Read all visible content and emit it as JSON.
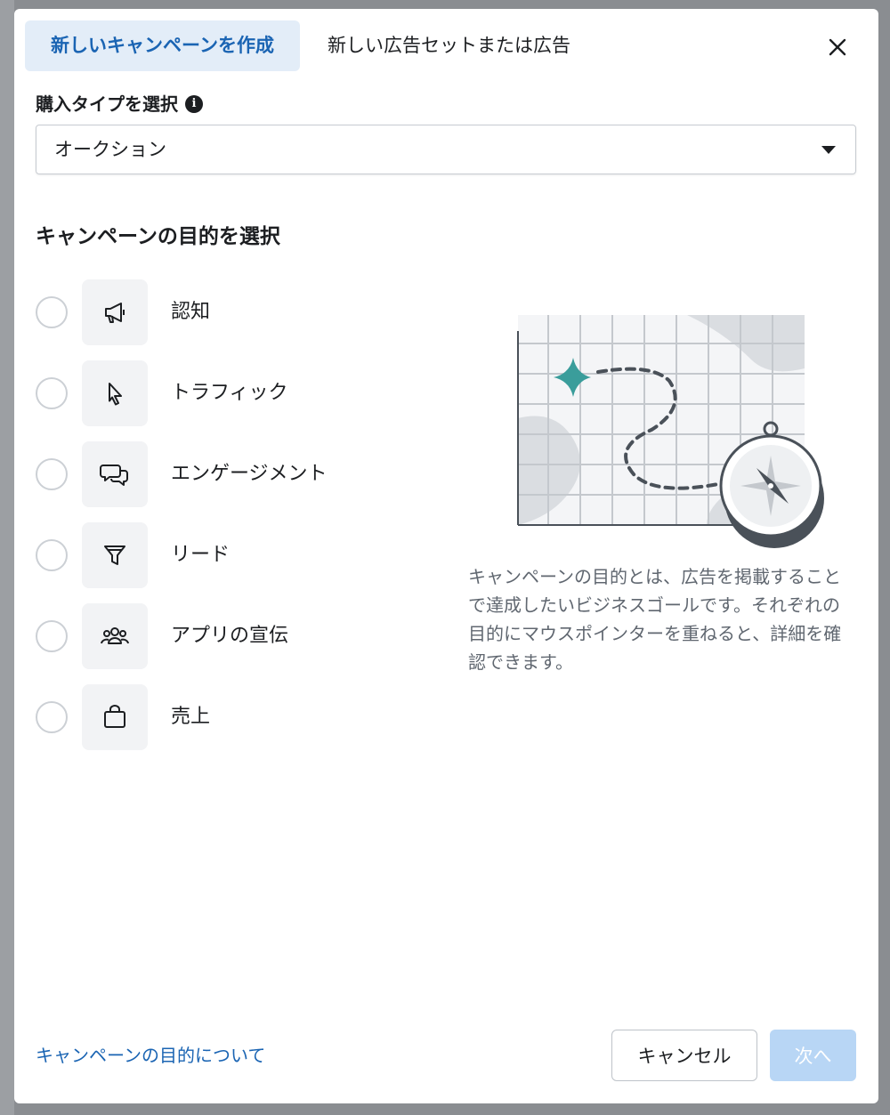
{
  "tabs": [
    {
      "label": "新しいキャンペーンを作成",
      "active": true
    },
    {
      "label": "新しい広告セットまたは広告",
      "active": false
    }
  ],
  "purchase": {
    "label": "購入タイプを選択",
    "info_icon": "info-icon",
    "selected": "オークション"
  },
  "objective": {
    "heading": "キャンペーンの目的を選択",
    "options": [
      {
        "label": "認知",
        "icon": "megaphone-icon"
      },
      {
        "label": "トラフィック",
        "icon": "cursor-icon"
      },
      {
        "label": "エンゲージメント",
        "icon": "chat-bubbles-icon"
      },
      {
        "label": "リード",
        "icon": "funnel-icon"
      },
      {
        "label": "アプリの宣伝",
        "icon": "people-icon"
      },
      {
        "label": "売上",
        "icon": "shopping-bag-icon"
      }
    ],
    "description": "キャンペーンの目的とは、広告を掲載することで達成したいビジネスゴールです。それぞれの目的にマウスポインターを重ねると、詳細を確認できます。",
    "illustration": "map-compass-illustration"
  },
  "footer": {
    "help_link": "キャンペーンの目的について",
    "cancel_label": "キャンセル",
    "next_label": "次へ"
  },
  "colors": {
    "accent": "#1a64b3",
    "tab_active_bg": "#e3edf8",
    "next_disabled_bg": "#b8d6f5",
    "illustration_teal": "#3a9d9b"
  }
}
